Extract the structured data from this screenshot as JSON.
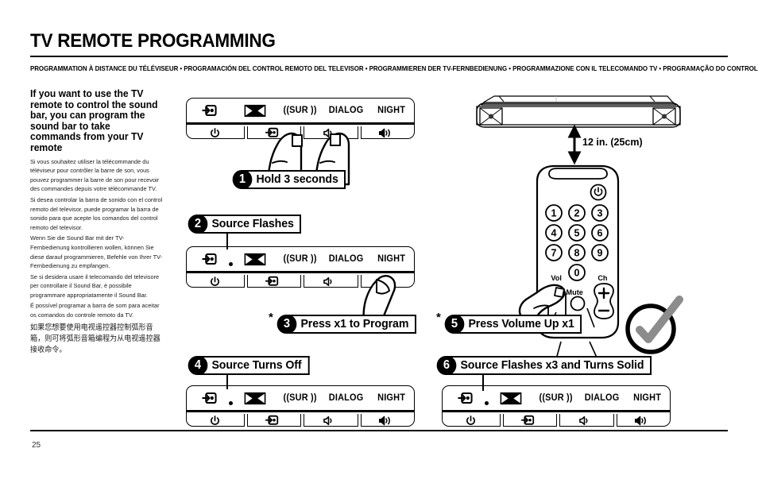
{
  "header": {
    "title": "TV REMOTE PROGRAMMING",
    "subtitle": "PROGRAMMATION À DISTANCE DU TÉLÉVISEUR • PROGRAMACIÓN DEL CONTROL REMOTO DEL TELEVISOR • PROGRAMMIEREN DER TV-FERNBEDIENUNG • PROGRAMMAZIONE CON IL TELECOMANDO TV • PROGRAMAÇÃO DO CONTROLE REMOTO DA TV • 电视机遥控器编程"
  },
  "page_number": "25",
  "intro": {
    "heading": "If you want to use the TV remote to control the sound bar, you can program the sound bar to take commands from your TV remote",
    "paragraphs": [
      "Si vous souhaitez utiliser la télécommande du téléviseur pour contrôler la barre de son, vous pouvez programmer la barre de son pour recevoir des commandes depuis votre télécommande TV.",
      "Si desea controlar la barra de sonido con el control remoto del televisor, puede programar la barra de sonido para que acepte los comandos del control remoto del televisor.",
      "Wenn Sie die Sound Bar mit der TV-Fernbedienung kontrollieren wollen, können Sie diese darauf programmieren, Befehle von Ihrer TV-Fernbedienung zu empfangen.",
      "Se si desidera usare il telecomando del televisore per controllare il Sound Bar, è possibile programmare appropriatamente il Sound Bar.",
      "É possível programar a barra de som para aceitar os comandos do controle remoto da TV."
    ],
    "paragraph_cjk": "如果您想要使用电视遥控器控制弧形音箱，则可将弧形音箱编程为从电视遥控器接收命令。"
  },
  "soundbar_panel": {
    "indicators": [
      {
        "name": "source",
        "icon": "source-input-icon",
        "label": ""
      },
      {
        "name": "dolby",
        "icon": "dolby-icon",
        "label": ""
      },
      {
        "name": "surround",
        "icon": "text",
        "label": "((SUR ))"
      },
      {
        "name": "dialog",
        "icon": "text",
        "label": "DIALOG"
      },
      {
        "name": "night",
        "icon": "text",
        "label": "NIGHT"
      }
    ],
    "buttons": [
      {
        "name": "power",
        "icon": "power-icon"
      },
      {
        "name": "source",
        "icon": "source-input-icon"
      },
      {
        "name": "volume-down",
        "icon": "volume-down-icon"
      },
      {
        "name": "volume-up",
        "icon": "volume-up-icon"
      }
    ]
  },
  "steps": [
    {
      "number": "1",
      "text": "Hold 3 seconds",
      "asterisk": false
    },
    {
      "number": "2",
      "text": "Source Flashes",
      "asterisk": false
    },
    {
      "number": "3",
      "text": "Press x1 to Program",
      "asterisk": true
    },
    {
      "number": "4",
      "text": "Source Turns Off",
      "asterisk": false
    },
    {
      "number": "5",
      "text": "Press Volume Up x1",
      "asterisk": true
    },
    {
      "number": "6",
      "text": "Source Flashes x3 and Turns Solid",
      "asterisk": false
    }
  ],
  "distance": {
    "label": "12 in. (25cm)"
  },
  "remote": {
    "keypad": [
      "1",
      "2",
      "3",
      "4",
      "5",
      "6",
      "7",
      "8",
      "9",
      "0"
    ],
    "power_icon": "power-icon",
    "vol_label": "Vol",
    "ch_label": "Ch",
    "mute_label": "Mute",
    "ch_up": "+",
    "ch_down": "−"
  },
  "asterisk_mark": "*",
  "colors": {
    "ink": "#000000",
    "check": "#8c8c8c",
    "paper": "#ffffff"
  }
}
